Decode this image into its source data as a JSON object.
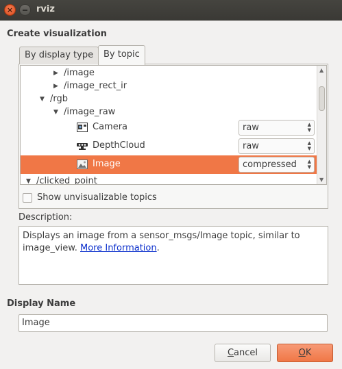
{
  "window": {
    "title": "rviz",
    "close_glyph": "×"
  },
  "create_heading": "Create visualization",
  "tabs": [
    {
      "label": "By display type",
      "active": false
    },
    {
      "label": "By topic",
      "active": true
    }
  ],
  "tree": {
    "rows": [
      {
        "label": "/image",
        "arrow": "▶",
        "selected": false
      },
      {
        "label": "/image_rect_ir",
        "arrow": "▶",
        "selected": false
      },
      {
        "label": "/rgb",
        "arrow": "▼",
        "selected": false
      },
      {
        "label": "/image_raw",
        "arrow": "▼",
        "selected": false
      },
      {
        "label": "Camera",
        "icon": "camera-display-icon",
        "combo": "raw",
        "selected": false
      },
      {
        "label": "DepthCloud",
        "icon": "depthcloud-icon",
        "combo": "raw",
        "selected": false
      },
      {
        "label": "Image",
        "icon": "image-display-icon",
        "combo": "compressed",
        "selected": true
      },
      {
        "label": "/clicked_point",
        "arrow": "▼",
        "selected": false
      }
    ],
    "combo_arrows": "▲▼",
    "scroll_up": "▲",
    "scroll_down": "▼"
  },
  "show_unvisualizable": {
    "label": "Show unvisualizable topics",
    "checked": false
  },
  "description": {
    "label": "Description:",
    "text": "Displays an image from a sensor_msgs/Image topic, similar to image_view. ",
    "link": "More Information",
    "trailing": "."
  },
  "display_name": {
    "label": "Display Name",
    "value": "Image"
  },
  "buttons": {
    "cancel": {
      "mnemonic": "C",
      "rest": "ancel"
    },
    "ok": {
      "mnemonic": "O",
      "rest": "K"
    }
  },
  "colors": {
    "accent": "#f07746",
    "titlebar": "#3c3b37",
    "link": "#0b2fcc"
  }
}
